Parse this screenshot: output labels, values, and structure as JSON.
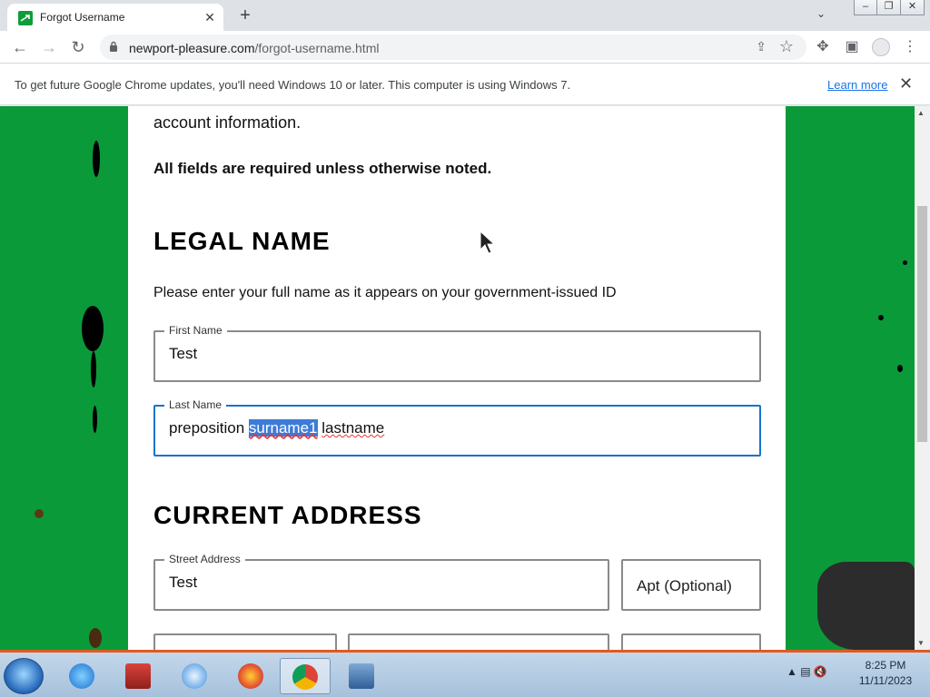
{
  "browser": {
    "tab_title": "Forgot Username",
    "url_host": "newport-pleasure.com",
    "url_path": "/forgot-username.html"
  },
  "infobar": {
    "message": "To get future Google Chrome updates, you'll need Windows 10 or later. This computer is using Windows 7.",
    "learn_more": "Learn more"
  },
  "form": {
    "intro": "account information.",
    "required_note": "All fields are required unless otherwise noted.",
    "legal_name_heading": "LEGAL NAME",
    "legal_name_subtext": "Please enter your full name as it appears on your government-issued ID",
    "first_name": {
      "label": "First Name",
      "value": "Test"
    },
    "last_name": {
      "label": "Last Name",
      "value_part1": "preposition",
      "value_selected": "surname1",
      "value_part2": "lastname"
    },
    "current_address_heading": "CURRENT ADDRESS",
    "street_address": {
      "label": "Street Address",
      "value": "Test"
    },
    "apt": {
      "placeholder": "Apt (Optional)"
    }
  },
  "taskbar": {
    "apps": [
      "internet-explorer",
      "store",
      "itunes",
      "firefox",
      "chrome",
      "app"
    ],
    "active_app": "chrome",
    "time": "8:25 PM",
    "date": "11/11/2023"
  },
  "colors": {
    "page_green": "#0b9a3a",
    "focus_blue": "#1a73c8",
    "selection": "#3d7bd8"
  }
}
